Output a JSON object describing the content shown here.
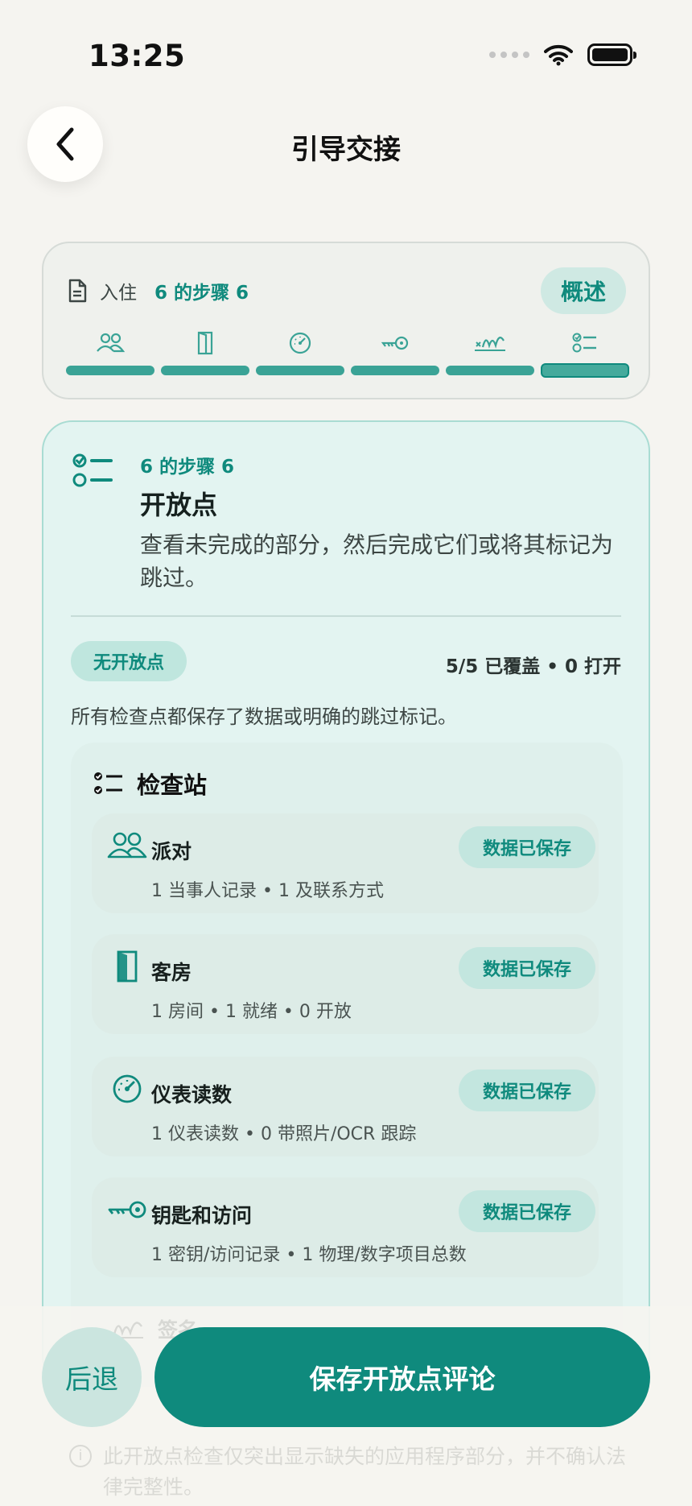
{
  "status_bar": {
    "time": "13:25"
  },
  "nav": {
    "title": "引导交接"
  },
  "progress": {
    "section_label": "入住",
    "step_label": "6 的步骤 6",
    "overview_label": "概述",
    "current_step": 6,
    "total_steps": 6,
    "step_icons": [
      "people-icon",
      "door-icon",
      "gauge-icon",
      "key-icon",
      "signature-icon",
      "checklist-icon"
    ]
  },
  "main": {
    "step_label": "6 的步骤 6",
    "title": "开放点",
    "description": "查看未完成的部分，然后完成它们或将其标记为跳过。",
    "badge": "无开放点",
    "coverage": "5/5 已覆盖 • 0 打开",
    "summary": "所有检查点都保存了数据或明确的跳过标记。"
  },
  "checkpoints": {
    "title": "检查站",
    "items": [
      {
        "name": "派对",
        "sub": "1 当事人记录 • 1 及联系方式",
        "status": "数据已保存",
        "icon": "people-icon"
      },
      {
        "name": "客房",
        "sub": "1 房间 • 1 就绪 • 0 开放",
        "status": "数据已保存",
        "icon": "door-icon"
      },
      {
        "name": "仪表读数",
        "sub": "1 仪表读数 • 0 带照片/OCR 跟踪",
        "status": "数据已保存",
        "icon": "gauge-icon"
      },
      {
        "name": "钥匙和访问",
        "sub": "1 密钥/访问记录 • 1 物理/数字项目总数",
        "status": "数据已保存",
        "icon": "key-icon"
      }
    ],
    "faded_item_name": "签名"
  },
  "footer_note": "此开放点检查仅突出显示缺失的应用程序部分，并不确认法律完整性。",
  "actions": {
    "back_label": "后退",
    "save_label": "保存开放点评论"
  },
  "colors": {
    "accent": "#0f8a7d",
    "background": "#f5f4f0",
    "card": "#e3f4f1"
  }
}
